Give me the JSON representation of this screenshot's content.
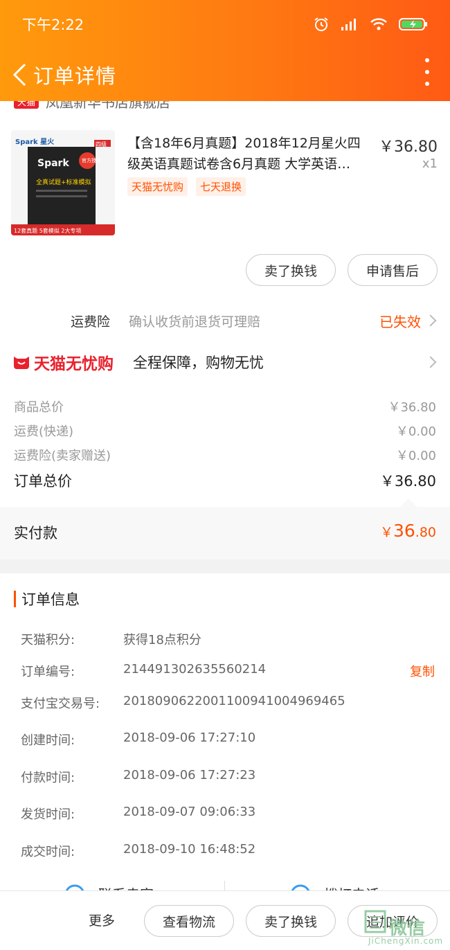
{
  "status_bar": {
    "time": "下午2:22"
  },
  "nav": {
    "title": "订单详情"
  },
  "store": {
    "tag": "天猫",
    "name": "凤凰新华书店旗舰店"
  },
  "product": {
    "title_line1": "【含18年6月真题】2018年12月星火四",
    "title_line2": "级英语真题试卷含6月真题 大学英语…",
    "price": "￥36.80",
    "qty": "x1",
    "tags": [
      "天猫无忧购",
      "七天退换"
    ],
    "image_labels": {
      "brand": "Spark星火英语",
      "level": "四级",
      "main": "全真试题+标准模拟",
      "badge": "官方授权",
      "footer": "12套真题 5套模拟 2大专项"
    }
  },
  "actions": {
    "sell_label": "卖了换钱",
    "after_sale_label": "申请售后"
  },
  "insurance": {
    "label": "运费险",
    "desc": "确认收货前退货可理赔",
    "status": "已失效"
  },
  "wuyou": {
    "logo_text": "天猫无忧购",
    "desc": "全程保障，购物无忧"
  },
  "prices": {
    "goods_label": "商品总价",
    "goods_value": "￥36.80",
    "shipping_label": "运费(快递)",
    "shipping_value": "￥0.00",
    "insurance_label": "运费险(卖家赠送)",
    "insurance_value": "￥0.00",
    "total_label": "订单总价",
    "total_value": "￥36.80"
  },
  "paid": {
    "label": "实付款",
    "currency": "￥",
    "integer": "36",
    "decimal": ".80"
  },
  "order_info": {
    "title": "订单信息",
    "rows": [
      {
        "key": "天猫积分:",
        "value": "获得18点积分"
      },
      {
        "key": "订单编号:",
        "value": "214491302635560214",
        "action": "复制"
      },
      {
        "key": "支付宝交易号:",
        "value": "2018090622001100941004969465"
      },
      {
        "key": "创建时间:",
        "value": "2018-09-06 17:27:10"
      },
      {
        "key": "付款时间:",
        "value": "2018-09-06 17:27:23"
      },
      {
        "key": "发货时间:",
        "value": "2018-09-07 09:06:33"
      },
      {
        "key": "成交时间:",
        "value": "2018-09-10 16:48:52"
      }
    ]
  },
  "partial_links": {
    "left": "联系卖家",
    "right": "拨打电话"
  },
  "bottom_bar": {
    "more": "更多",
    "logistics": "查看物流",
    "sell": "卖了换钱",
    "review": "追加评价"
  },
  "watermark": {
    "text": "微信",
    "url": "JiChengXin.com"
  }
}
